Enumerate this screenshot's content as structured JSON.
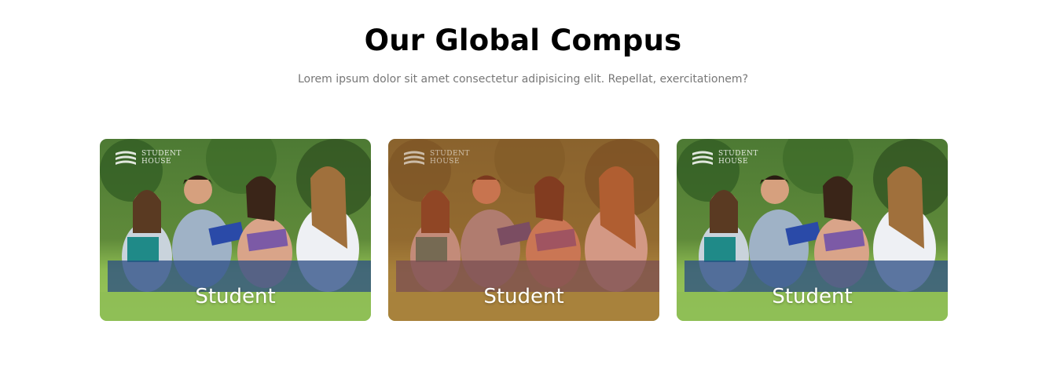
{
  "section": {
    "title": "Our Global Compus",
    "subtitle": "Lorem ipsum dolor sit amet consectetur adipisicing elit. Repellat, exercitationem?"
  },
  "cards": [
    {
      "label": "Student",
      "logo_line1": "STUDENT",
      "logo_line2": "HOUSE",
      "overlay": false,
      "icon": "book-stack-icon"
    },
    {
      "label": "Student",
      "logo_line1": "STUDENT",
      "logo_line2": "HOUSE",
      "overlay": true,
      "icon": "book-stack-icon"
    },
    {
      "label": "Student",
      "logo_line1": "STUDENT",
      "logo_line2": "HOUSE",
      "overlay": false,
      "icon": "book-stack-icon"
    }
  ],
  "colors": {
    "overlay": "#be5028",
    "grass": "#7fb34a",
    "trees": "#3f6a2a"
  }
}
